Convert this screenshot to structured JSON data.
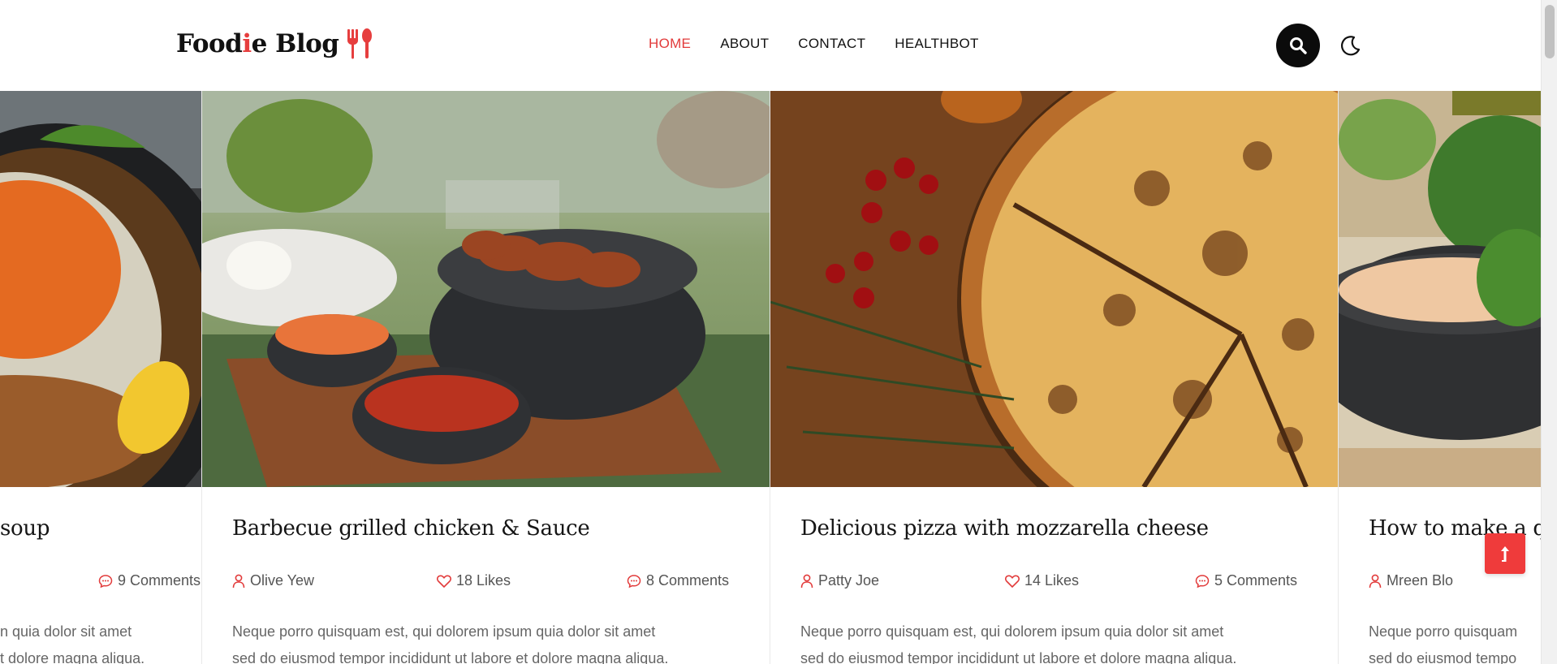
{
  "header": {
    "logo": {
      "part1": "Food",
      "accent": "i",
      "part2": "e Blog"
    },
    "nav": [
      {
        "label": "HOME",
        "active": true
      },
      {
        "label": "ABOUT",
        "active": false
      },
      {
        "label": "CONTACT",
        "active": false
      },
      {
        "label": "HEALTHBOT",
        "active": false
      }
    ]
  },
  "colors": {
    "accent": "#e63e3e",
    "dark": "#0b0b0b"
  },
  "cards": [
    {
      "title": "soup",
      "comments": "9 Comments",
      "excerpt_1": "n quia dolor sit amet",
      "excerpt_2": "t dolore magna aliqua."
    },
    {
      "title": "Barbecue grilled chicken & Sauce",
      "author": "Olive Yew",
      "likes": "18 Likes",
      "comments": "8 Comments",
      "excerpt_1": "Neque porro quisquam est, qui dolorem ipsum quia dolor sit amet",
      "excerpt_2": "sed do eiusmod tempor incididunt ut labore et dolore magna aliqua."
    },
    {
      "title": "Delicious pizza with mozzarella cheese",
      "author": "Patty Joe",
      "likes": "14 Likes",
      "comments": "5 Comments",
      "excerpt_1": "Neque porro quisquam est, qui dolorem ipsum quia dolor sit amet",
      "excerpt_2": "sed do eiusmod tempor incididunt ut labore et dolore magna aliqua."
    },
    {
      "title": "How to make a qu",
      "author": "Mreen Blo",
      "excerpt_1": "Neque porro quisquam",
      "excerpt_2": "sed do eiusmod tempo"
    }
  ]
}
